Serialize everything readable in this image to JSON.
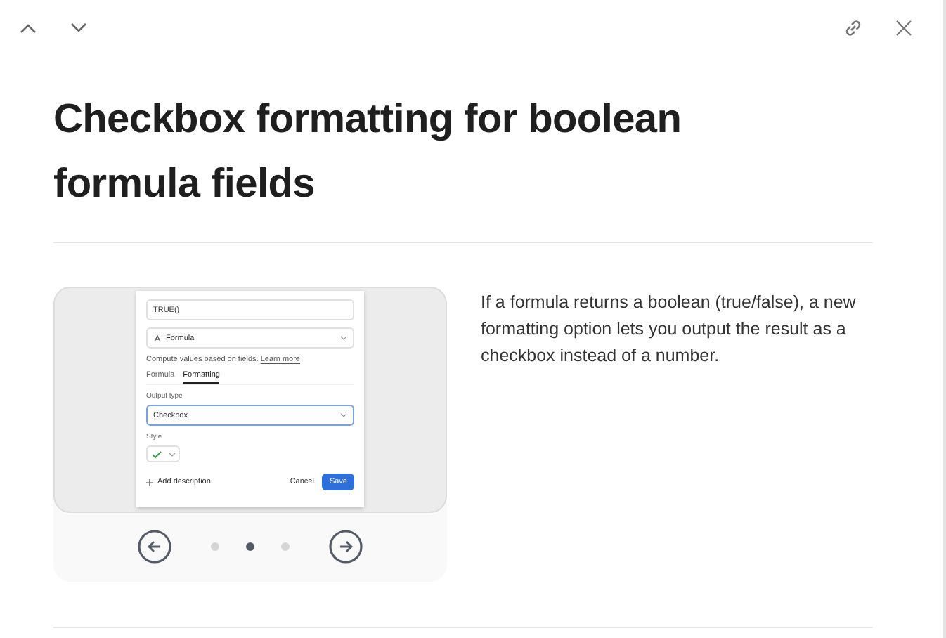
{
  "title": "Checkbox formatting for boolean formula fields",
  "description": "If a formula returns a boolean (true/false), a new formatting option lets you output the result as a checkbox instead of a number.",
  "slide": {
    "formula_value": "TRUE()",
    "field_type": "Formula",
    "help_text": "Compute values based on fields.",
    "help_link": "Learn more",
    "tabs": [
      {
        "label": "Formula",
        "selected": false
      },
      {
        "label": "Formatting",
        "selected": true
      }
    ],
    "output_label": "Output type",
    "output_value": "Checkbox",
    "style_label": "Style",
    "style_checked": true,
    "add_label": "Add description",
    "cancel_label": "Cancel",
    "save_label": "Save"
  },
  "carousel": {
    "dots": [
      {
        "selected": false
      },
      {
        "selected": true
      },
      {
        "selected": false
      }
    ]
  }
}
